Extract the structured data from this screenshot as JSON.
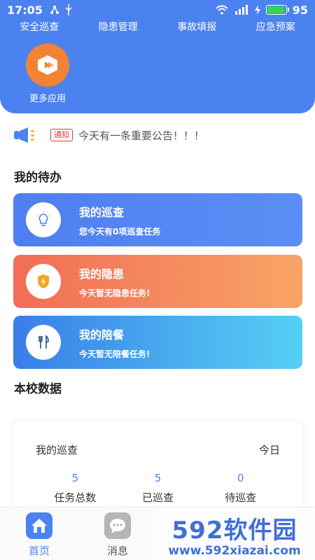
{
  "statusbar": {
    "time": "17:05",
    "battery": "95"
  },
  "quick_nav": [
    "安全巡查",
    "隐患管理",
    "事故填报",
    "应急预案"
  ],
  "more_apps": {
    "label": "更多应用"
  },
  "notice": {
    "badge": "通知",
    "text": "今天有一条重要公告！！！"
  },
  "todo": {
    "title": "我的待办",
    "cards": [
      {
        "title": "我的巡查",
        "sub": "您今天有0项巡查任务",
        "icon": "lightbulb-icon"
      },
      {
        "title": "我的隐患",
        "sub": "今天暂无隐患任务!",
        "icon": "shield-bolt-icon"
      },
      {
        "title": "我的陪餐",
        "sub": "今天暂无陪餐任务!",
        "icon": "fork-knife-icon"
      }
    ]
  },
  "school_data": {
    "title": "本校数据",
    "card": {
      "title": "我的巡查",
      "period": "今日",
      "stats": [
        {
          "value": "5",
          "label": "任务总数"
        },
        {
          "value": "5",
          "label": "已巡查"
        },
        {
          "value": "0",
          "label": "待巡查"
        }
      ]
    }
  },
  "tabbar": {
    "home": "首页",
    "messages": "消息"
  },
  "watermark": {
    "main": "592软件园",
    "sub": "www.592xiazai.com"
  },
  "colors": {
    "primary": "#4c82f0",
    "orange": "#f28234",
    "hazard": "#f26d56",
    "notice_red": "#e0393a"
  }
}
